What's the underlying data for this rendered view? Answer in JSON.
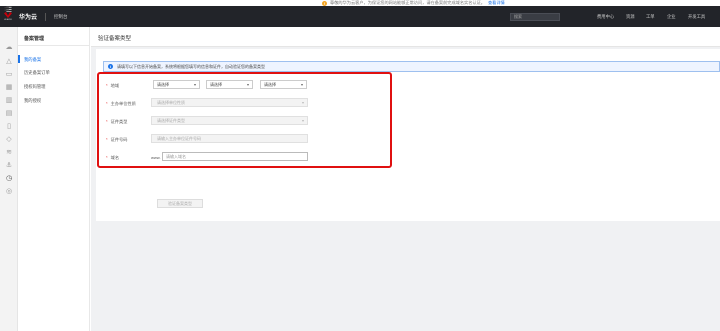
{
  "notice": {
    "text": "尊敬的华为云客户，为保证您的网站能够正常访问，请在备案前完成域名实名认证。",
    "link": "查看详情"
  },
  "header": {
    "brand": "华为云",
    "logo_text": "HUAWEI",
    "console": "控制台",
    "search_placeholder": "搜索",
    "nav": [
      "费用中心",
      "资源",
      "工单",
      "企业",
      "开发工具"
    ]
  },
  "rail_icons": [
    "cloud-icon",
    "warning-icon",
    "server-icon",
    "grid-icon",
    "chart-icon",
    "database-icon",
    "document-icon",
    "shield-icon",
    "layers-icon",
    "anchor-icon",
    "clock-icon",
    "globe-icon"
  ],
  "sidebar": {
    "title": "备案管理",
    "items": [
      {
        "label": "我的备案",
        "active": true
      },
      {
        "label": "历史备案订单",
        "active": false
      },
      {
        "label": "授权码管理",
        "active": false
      },
      {
        "label": "我的授权",
        "active": false
      }
    ]
  },
  "page": {
    "title": "验证备案类型",
    "info_text": "请填写以下信息开始备案，系统将根据您填写的信息和证件，自动验证您的备案类型"
  },
  "form": {
    "region": {
      "label": "地域",
      "selects": [
        "请选择",
        "请选择",
        "请选择"
      ]
    },
    "org_nature": {
      "label": "主办单位性质",
      "placeholder": "请选择单位性质"
    },
    "cert_type": {
      "label": "证件类型",
      "placeholder": "请选择证件类型"
    },
    "cert_number": {
      "label": "证件号码",
      "placeholder": "请输入主办单位证件号码"
    },
    "domain": {
      "label": "域名",
      "prefix": "www.",
      "placeholder": "请输入域名"
    },
    "submit_label": "验证备案类型"
  }
}
